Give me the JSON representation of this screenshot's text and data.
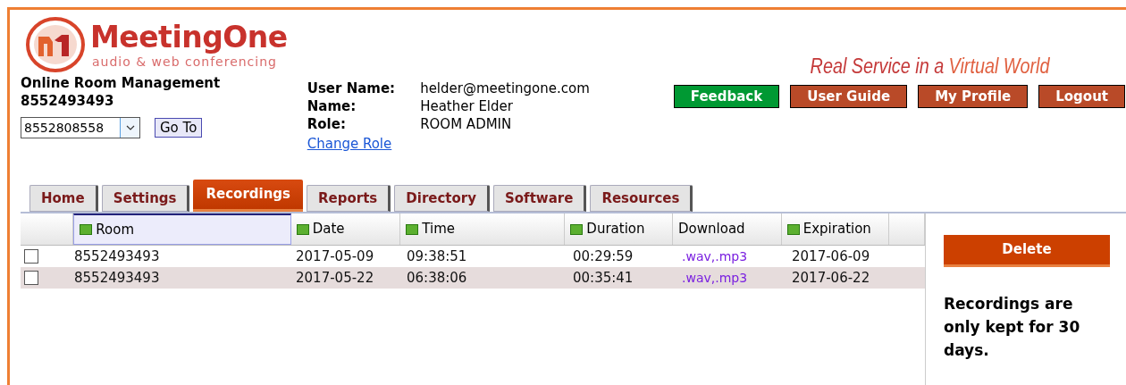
{
  "logo": {
    "name": "MeetingOne",
    "tagline": "audio & web conferencing"
  },
  "slogan": {
    "first": "Real Service in a",
    "second": "Virtual World"
  },
  "room_management": {
    "title": "Online Room Management",
    "number": "8552493493",
    "select_value": "8552808558",
    "go_button": "Go To"
  },
  "user_info": [
    {
      "label": "User Name:",
      "value": "helder@meetingone.com"
    },
    {
      "label": "Name:",
      "value": "Heather Elder"
    },
    {
      "label": "Role:",
      "value": "ROOM ADMIN"
    }
  ],
  "change_role_link": "Change Role",
  "top_buttons": [
    {
      "label": "Feedback",
      "color": "#009933"
    },
    {
      "label": "User Guide",
      "color": "#b94a28"
    },
    {
      "label": "My Profile",
      "color": "#b94a28"
    },
    {
      "label": "Logout",
      "color": "#b94a28"
    }
  ],
  "tabs": [
    {
      "label": "Home",
      "selected": false
    },
    {
      "label": "Settings",
      "selected": false
    },
    {
      "label": "Recordings",
      "selected": true
    },
    {
      "label": "Reports",
      "selected": false
    },
    {
      "label": "Directory",
      "selected": false
    },
    {
      "label": "Software",
      "selected": false
    },
    {
      "label": "Resources",
      "selected": false
    }
  ],
  "table": {
    "columns": [
      {
        "label": "Room",
        "sortable": true,
        "selected": true
      },
      {
        "label": "Date",
        "sortable": true,
        "selected": false
      },
      {
        "label": "Time",
        "sortable": true,
        "selected": false
      },
      {
        "label": "Duration",
        "sortable": true,
        "selected": false
      },
      {
        "label": "Download",
        "sortable": false,
        "selected": false
      },
      {
        "label": "Expiration",
        "sortable": true,
        "selected": false
      }
    ],
    "rows": [
      {
        "checked": false,
        "room": "8552493493",
        "date": "2017-05-09",
        "time": "09:38:51",
        "duration": "00:29:59",
        "download": ".wav,.mp3",
        "expiration": "2017-06-09"
      },
      {
        "checked": false,
        "room": "8552493493",
        "date": "2017-05-22",
        "time": "06:38:06",
        "duration": "00:35:41",
        "download": ".wav,.mp3",
        "expiration": "2017-06-22"
      }
    ]
  },
  "delete_button": "Delete",
  "note": "Recordings are only kept for 30 days."
}
